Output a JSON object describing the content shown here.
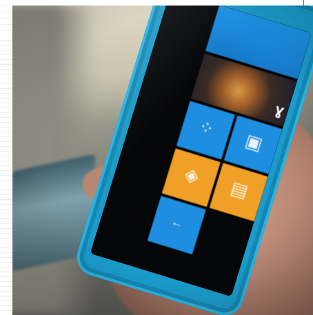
{
  "photo": {
    "subject": "",
    "colors": {
      "phone_body": "#1b9bc9",
      "tile_blue": "#1e8fe0",
      "tile_orange": "#f0a026",
      "screen_bg": "#050608"
    }
  },
  "tiles": [
    {
      "id": "header",
      "label": "",
      "color": "#1e8fe0"
    },
    {
      "id": "pictures",
      "label": "",
      "color": "#1e8fe0"
    },
    {
      "id": "marketplace",
      "label": "",
      "color": "#1e8fe0"
    },
    {
      "id": "office",
      "label": "",
      "color": "#1e8fe0"
    },
    {
      "id": "store",
      "label": "",
      "color": "#f0a026"
    },
    {
      "id": "music",
      "label": "",
      "color": "#f0a026"
    },
    {
      "id": "bottom",
      "label": "",
      "color": "#1e8fe0"
    }
  ],
  "icons": {
    "people": "people-icon",
    "marketplace": "marketplace-icon",
    "office": "office-icon",
    "store": "shopping-bag-icon",
    "music": "music-icon",
    "back": "back-icon"
  }
}
